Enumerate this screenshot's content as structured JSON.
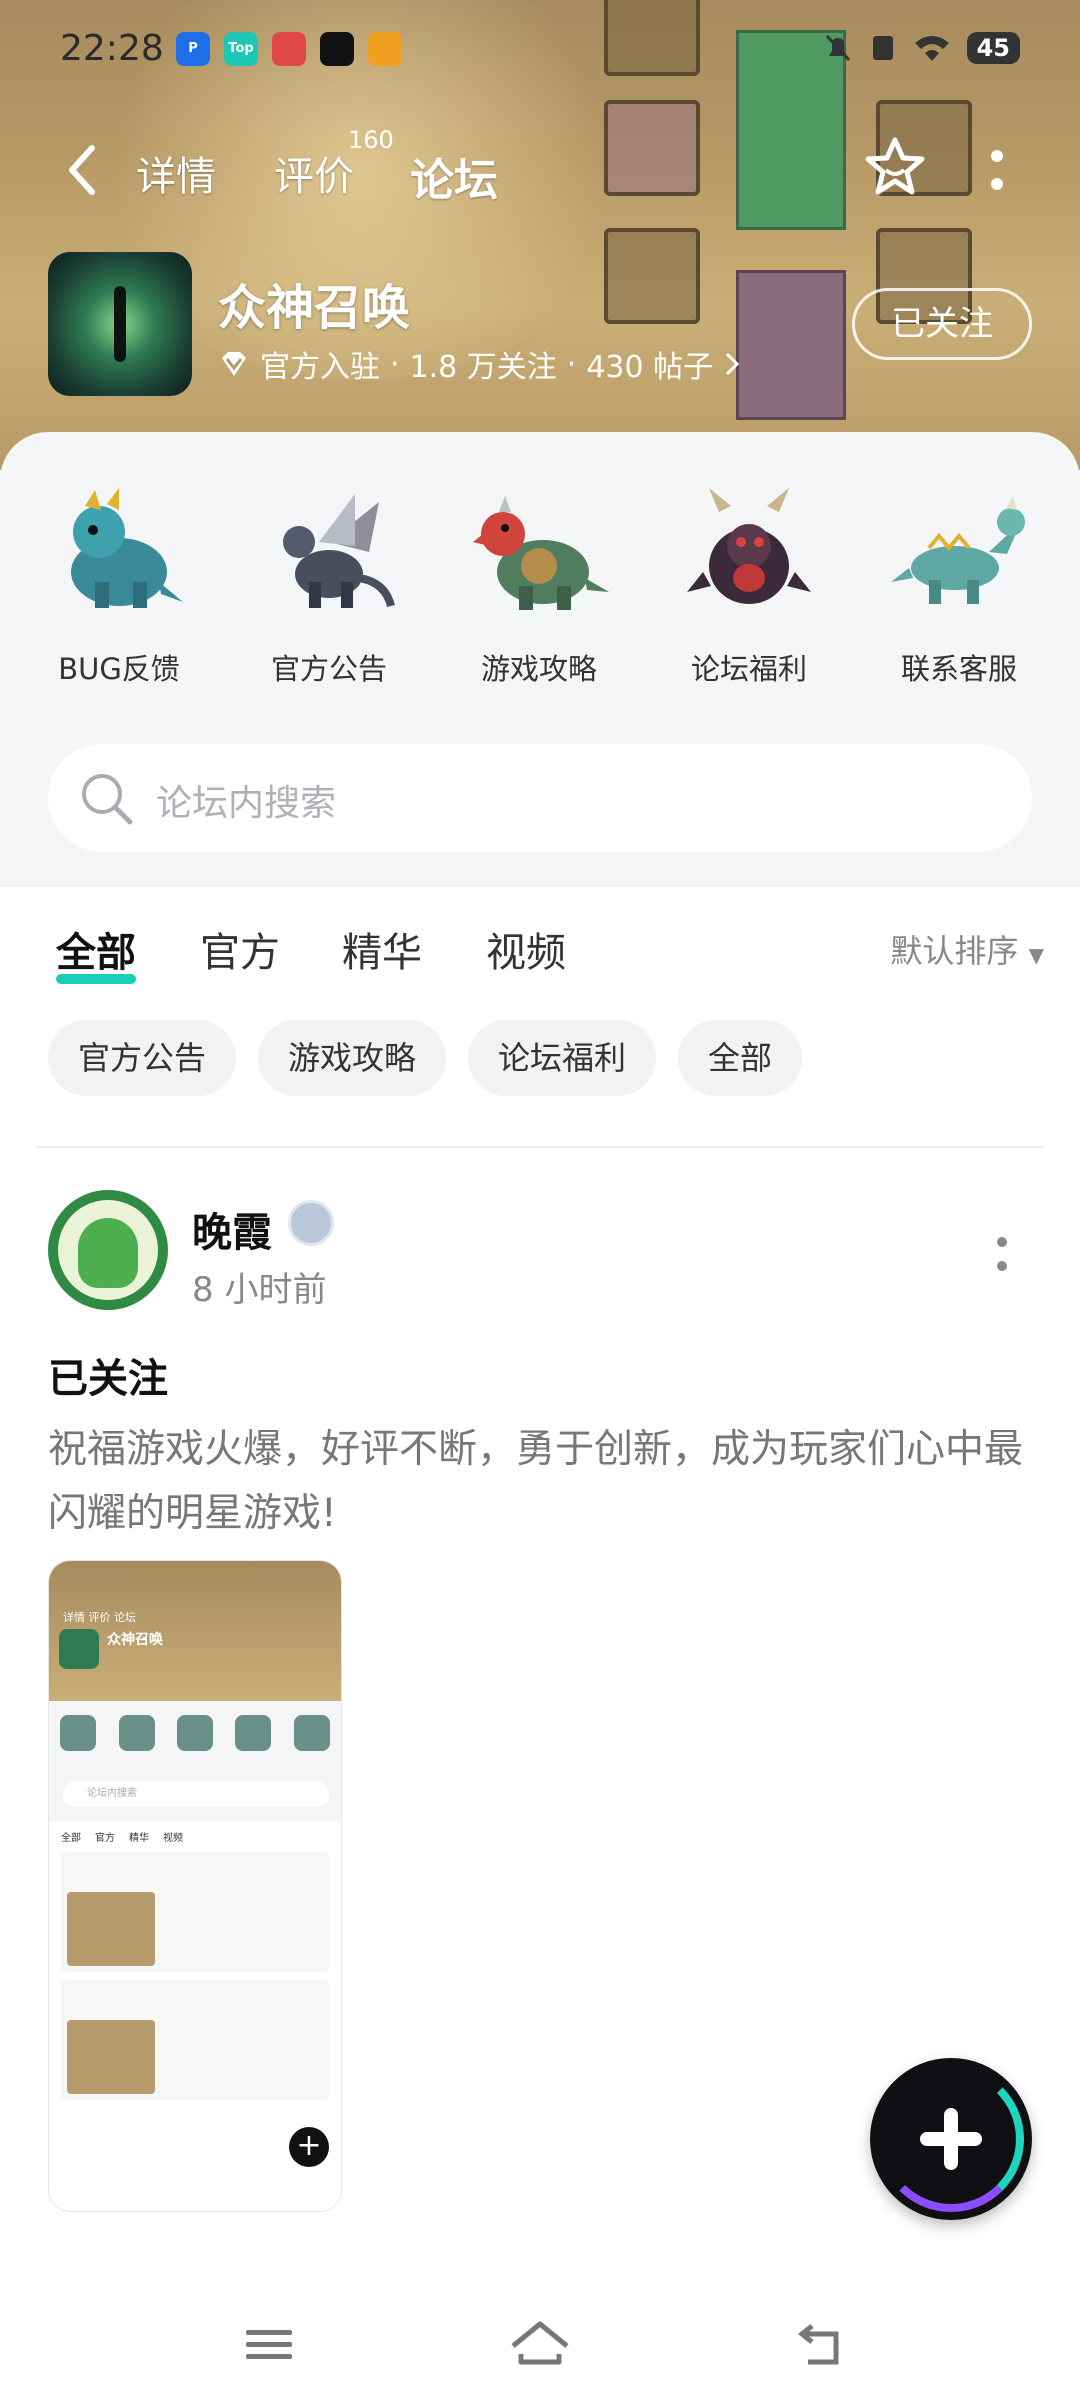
{
  "status_bar": {
    "time": "22:28",
    "apps": [
      "P",
      "Top",
      "",
      "",
      ""
    ],
    "battery": "45"
  },
  "nav": {
    "tabs": [
      {
        "label": "详情"
      },
      {
        "label": "评价"
      },
      {
        "label": "论坛"
      }
    ],
    "review_count": "160",
    "active_tab": "论坛"
  },
  "forum": {
    "name": "众神召唤",
    "official": "官方入驻",
    "followers": "1.8 万关注",
    "posts": "430 帖子",
    "follow_label": "已关注"
  },
  "categories": [
    {
      "label": "BUG反馈"
    },
    {
      "label": "官方公告"
    },
    {
      "label": "游戏攻略"
    },
    {
      "label": "论坛福利"
    },
    {
      "label": "联系客服"
    }
  ],
  "search": {
    "placeholder": "论坛内搜索"
  },
  "sort_tabs": {
    "tabs": [
      "全部",
      "官方",
      "精华",
      "视频"
    ],
    "sort_label": "默认排序"
  },
  "chips": [
    "官方公告",
    "游戏攻略",
    "论坛福利",
    "全部"
  ],
  "post": {
    "author": "晚霞",
    "time": "8 小时前",
    "title": "已关注",
    "body": "祝福游戏火爆，好评不断，勇于创新，成为玩家们心中最闪耀的明星游戏!"
  },
  "thumbnail": {
    "title": "众神召唤",
    "nav": "详情  评价  论坛",
    "search": "论坛内搜索",
    "row": [
      "全部",
      "官方",
      "精华",
      "视频"
    ]
  },
  "colors": {
    "accent": "#18d0b8",
    "banner": "#b89a66",
    "panel": "#f4f5f7"
  }
}
